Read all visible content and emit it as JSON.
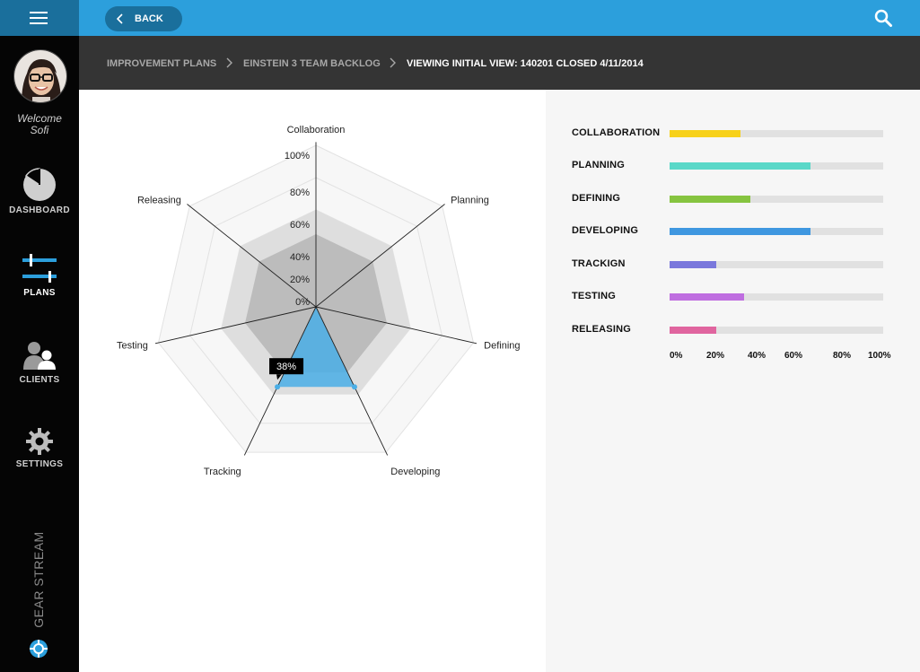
{
  "sidebar": {
    "menu_icon": "hamburger-menu-icon",
    "welcome": "Welcome",
    "user_name": "Sofi",
    "nav": [
      {
        "label": "DASHBOARD",
        "icon": "pie-chart-icon",
        "active": false
      },
      {
        "label": "PLANS",
        "icon": "sliders-icon",
        "active": true
      },
      {
        "label": "CLIENTS",
        "icon": "people-icon",
        "active": false
      },
      {
        "label": "SETTINGS",
        "icon": "gear-icon",
        "active": false
      }
    ],
    "brand": "GEAR STREAM",
    "brand_logo": "gearstream-logo-icon"
  },
  "topbar": {
    "back_label": "BACK",
    "search_icon": "search-icon",
    "color": "#2c9fdc",
    "dark_accent": "#1a6f9c"
  },
  "breadcrumb": {
    "items": [
      "IMPROVEMENT PLANS",
      "EINSTEIN 3 TEAM BACKLOG",
      "VIEWING INITIAL VIEW: 140201 CLOSED 4/11/2014"
    ]
  },
  "chart_data": [
    {
      "type": "radar",
      "categories": [
        "Collaboration",
        "Planning",
        "Defining",
        "Developing",
        "Tracking",
        "Testing",
        "Releasing"
      ],
      "tick_labels": [
        "0%",
        "20%",
        "40%",
        "60%",
        "80%",
        "100%"
      ],
      "rings": 5,
      "series": [
        {
          "values": [
            60,
            60,
            60,
            60,
            60,
            60,
            60
          ],
          "color": "#dedede"
        },
        {
          "values": [
            45,
            45,
            45,
            45,
            45,
            45,
            45
          ],
          "color": "#bcbcbc"
        },
        {
          "values": [
            0,
            0,
            0,
            55,
            55,
            0,
            0
          ],
          "color": "#4aaee6"
        }
      ],
      "tooltip": {
        "text": "38%"
      }
    },
    {
      "type": "bar",
      "orientation": "horizontal",
      "categories": [
        "COLLABORATION",
        "PLANNING",
        "DEFINING",
        "DEVELOPING",
        "TRACKIGN",
        "TESTING",
        "RELEASING"
      ],
      "values": [
        33,
        66,
        38,
        66,
        22,
        35,
        22
      ],
      "colors": [
        "#f7d11a",
        "#5ad8c8",
        "#86c440",
        "#3f97e0",
        "#7a78dc",
        "#bf6ee0",
        "#e0659f"
      ],
      "x_ticks": [
        "0%",
        "20%",
        "40%",
        "60%",
        "80%",
        "100%"
      ],
      "xlim": [
        0,
        100
      ]
    }
  ]
}
